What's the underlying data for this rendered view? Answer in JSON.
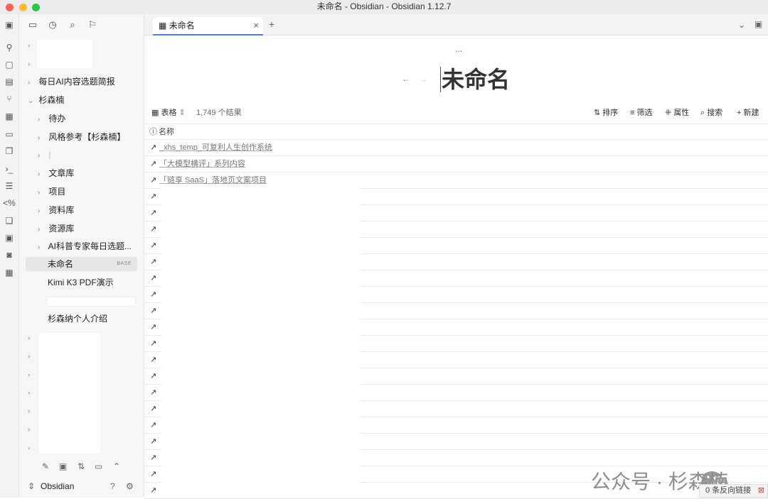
{
  "window": {
    "title": "未命名 - Obsidian - Obsidian 1.12.7"
  },
  "sidebar": {
    "items": [
      {
        "label": "每日AI内容选题简报",
        "chevron": "›"
      },
      {
        "label": "杉森楠",
        "chevron": "⌄"
      },
      {
        "label": "待办",
        "chevron": "›"
      },
      {
        "label": "风格参考【杉森楠】",
        "chevron": "›"
      },
      {
        "label": "文章库",
        "chevron": "›"
      },
      {
        "label": "项目",
        "chevron": "›"
      },
      {
        "label": "资料库",
        "chevron": "›"
      },
      {
        "label": "资源库",
        "chevron": "›"
      },
      {
        "label": "AI科普专家每日选题...",
        "chevron": "›"
      },
      {
        "label": "未命名",
        "badge": "BASE"
      },
      {
        "label": "Kimi K3 PDF演示"
      },
      {
        "label": "杉森纳个人介绍"
      }
    ],
    "vault_name": "Obsidian"
  },
  "tabs": [
    {
      "label": "未命名"
    }
  ],
  "note": {
    "more": "...",
    "title": "未命名"
  },
  "base_toolbar": {
    "view_label": "表格",
    "result_count": "1,749 个结果",
    "sort": "排序",
    "filter": "筛选",
    "properties": "属性",
    "search": "搜索",
    "new": "新建"
  },
  "table": {
    "column_header": "名称",
    "rows": [
      "_xhs_temp_可复利人生创作系统",
      "「大模型横评」系列内容",
      "「链享 SaaS」落地页文案项目"
    ]
  },
  "watermark": "公众号 · 杉森楠",
  "status": {
    "backlinks": "0 条反向链接"
  },
  "colors": {
    "accent": "#4a80d6",
    "traffic_red": "#ff5f57",
    "traffic_yellow": "#febc2e",
    "traffic_green": "#28c840"
  }
}
